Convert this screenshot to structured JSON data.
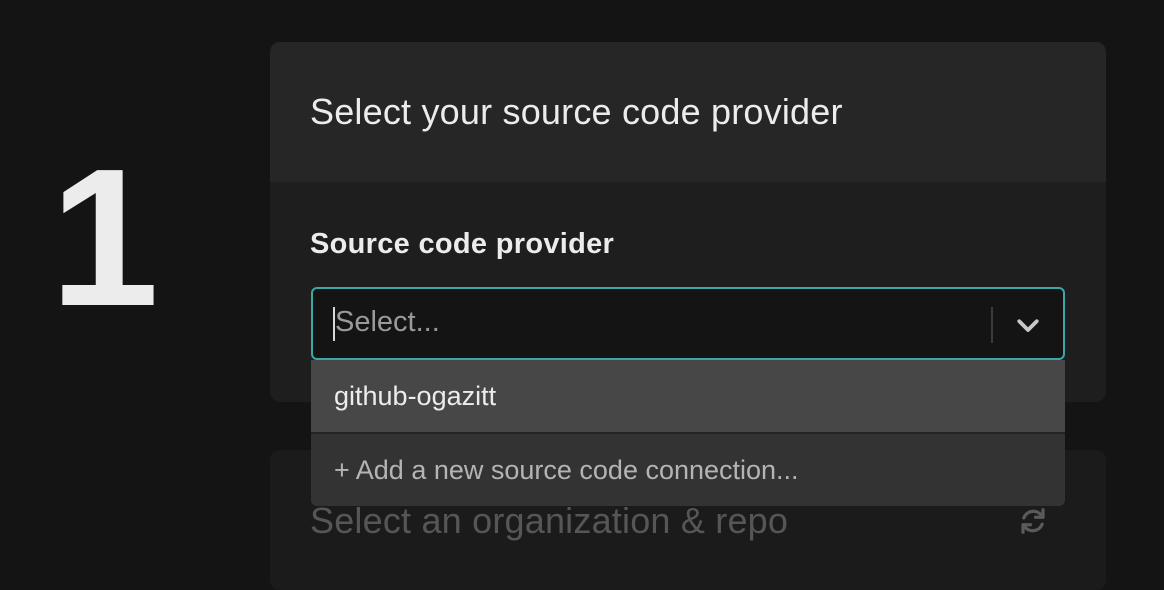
{
  "step": {
    "number": "1"
  },
  "provider_card": {
    "title": "Select your source code provider",
    "field_label": "Source code provider",
    "select": {
      "placeholder": "Select...",
      "chevron_icon": "chevron-down-icon"
    },
    "menu": {
      "options": [
        {
          "label": "github-ogazitt"
        }
      ],
      "add_connection_label": "+ Add a new source code connection..."
    }
  },
  "repo_card": {
    "title": "Select an organization & repo",
    "refresh_icon": "refresh-icon"
  },
  "colors": {
    "background": "#141414",
    "card": "#1e1e1e",
    "card_header": "#262626",
    "focus_border": "#3ba8a6",
    "menu": "#333333",
    "menu_option_highlight": "#474747"
  }
}
